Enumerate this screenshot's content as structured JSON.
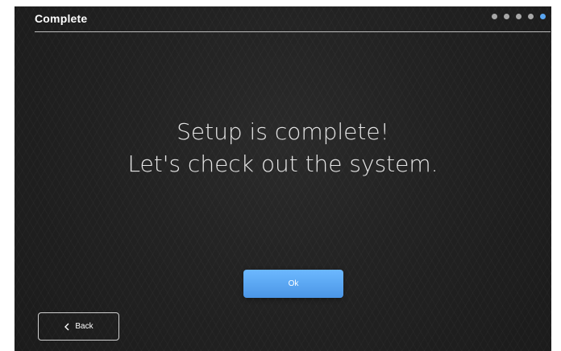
{
  "header": {
    "title": "Complete",
    "steps_total": 5,
    "current_step": 5,
    "active_color": "#5aa6f2",
    "inactive_color": "#a8a8a8"
  },
  "main": {
    "line1": "Setup is complete!",
    "line2": "Let's check out the system."
  },
  "buttons": {
    "ok_label": "Ok",
    "back_label": "Back"
  },
  "icons": {
    "back": "chevron-left-icon"
  }
}
